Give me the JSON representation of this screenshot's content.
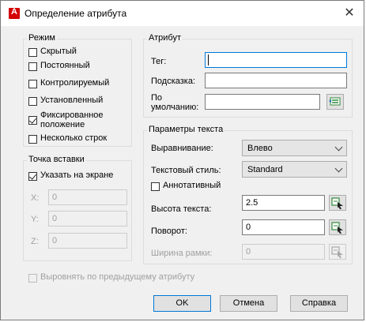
{
  "window": {
    "title": "Определение атрибута",
    "icon_letter": "A"
  },
  "mode": {
    "legend": "Режим",
    "hidden": "Скрытый",
    "constant": "Постоянный",
    "verify": "Контролируемый",
    "preset": "Установленный",
    "lock_position_line1": "Фиксированное",
    "lock_position_line2": "положение",
    "multiple_lines": "Несколько строк"
  },
  "insertion": {
    "legend": "Точка вставки",
    "specify_on_screen": "Указать на экране",
    "x_label": "X:",
    "y_label": "Y:",
    "z_label": "Z:",
    "x_value": "0",
    "y_value": "0",
    "z_value": "0"
  },
  "attribute": {
    "legend": "Атрибут",
    "tag_label": "Тег:",
    "tag_value": "",
    "prompt_label": "Подсказка:",
    "prompt_value": "",
    "default_label_line1": "По",
    "default_label_line2": "умолчанию:",
    "default_value": ""
  },
  "text_settings": {
    "legend": "Параметры текста",
    "justification_label": "Выравнивание:",
    "justification_value": "Влево",
    "style_label": "Текстовый стиль:",
    "style_value": "Standard",
    "annotative": "Аннотативный",
    "height_label": "Высота текста:",
    "height_value": "2.5",
    "rotation_label": "Поворот:",
    "rotation_value": "0",
    "boundary_width_label": "Ширина рамки:",
    "boundary_width_value": "0"
  },
  "align_below": "Выровнять по предыдущему атрибуту",
  "buttons": {
    "ok": "OK",
    "cancel": "Отмена",
    "help": "Справка"
  }
}
